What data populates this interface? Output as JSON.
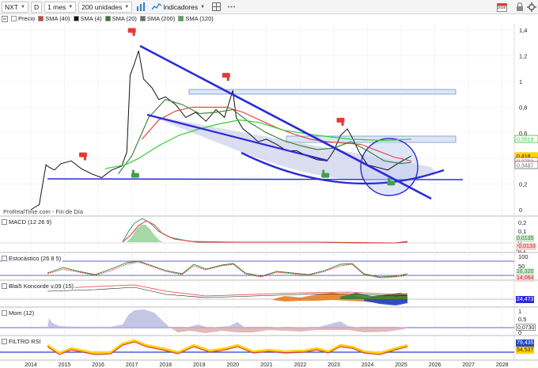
{
  "toolbar": {
    "symbol": "NXT",
    "mode": "D",
    "period": "1 mes",
    "units": "200 unidades",
    "indicators_label": "Indicadores",
    "year_badge": "2028"
  },
  "legend": [
    {
      "label": "Precio",
      "color": "#ffffff"
    },
    {
      "label": "SMA (40)",
      "color": "#e53935"
    },
    {
      "label": "SMA (4)",
      "color": "#111111"
    },
    {
      "label": "SMA (20)",
      "color": "#2e7d32"
    },
    {
      "label": "SMA (200)",
      "color": "#6d6d6d"
    },
    {
      "label": "SMA (120)",
      "color": "#4caf50"
    }
  ],
  "watermark": "ProRealTime.com - Fin de Día",
  "indicators": {
    "macd": "MACD (12 26 9)",
    "stoch": "Estocástico (26 8 5)",
    "blai5": "Blai5 Koncorde v.09 (15)",
    "mom": "Mom (12)",
    "rsi": "FILTRO RSI"
  },
  "colors": {
    "price_line": "#111111",
    "sma40": "#e53935",
    "sma20": "#2e7d32",
    "sma120": "#33cc33",
    "trendline": "#2b2bd6",
    "channel_fill": "#c8cbe8",
    "circle_fill": "#c5d1f5",
    "resistance_box": "#dbe6f7",
    "sell_flag": "#e53935",
    "buy_thumb": "#43a047"
  },
  "chart_data": [
    {
      "type": "line",
      "title": "",
      "x_unit": "year",
      "x_ticks": [
        "2014",
        "2015",
        "2016",
        "2017",
        "2018",
        "2019",
        "2020",
        "2021",
        "2022",
        "2023",
        "2024",
        "2025",
        "2026",
        "2027",
        "2028"
      ],
      "y_ticks": [
        "1,4",
        "1,2",
        "1",
        "0,8",
        "0,6",
        "0,4",
        "0,2",
        "0"
      ],
      "ylim": [
        0,
        1.45
      ],
      "last_value": "0,418",
      "price_tags": [
        {
          "label": "0,5519",
          "y": 0.5519,
          "color": "#33cc33"
        },
        {
          "label": "0,418",
          "y": 0.418,
          "color": "#ffd400"
        },
        {
          "label": "0,3792",
          "y": 0.3792,
          "color": "#e53935"
        },
        {
          "label": "0,3487",
          "y": 0.3487,
          "color": "#6d6d6d"
        }
      ],
      "series": [
        {
          "name": "Precio",
          "x": [
            2014.0,
            2014.25,
            2014.45,
            2014.55,
            2014.7,
            2014.9,
            2015.2,
            2015.5,
            2015.8,
            2016.1,
            2016.4,
            2016.7,
            2016.85,
            2016.95,
            2017.05,
            2017.2,
            2017.35,
            2017.6,
            2017.8,
            2018.0,
            2018.3,
            2018.6,
            2018.9,
            2019.2,
            2019.5,
            2019.75,
            2020.0,
            2020.1,
            2020.3,
            2020.5,
            2020.75,
            2021.0,
            2021.3,
            2021.6,
            2021.9,
            2022.2,
            2022.5,
            2022.8,
            2023.0,
            2023.2,
            2023.4,
            2023.55,
            2023.75,
            2024.0,
            2024.3,
            2024.6,
            2024.9,
            2025.1,
            2025.3
          ],
          "y": [
            0.0,
            0.04,
            0.35,
            0.33,
            0.31,
            0.36,
            0.38,
            0.32,
            0.28,
            0.25,
            0.31,
            0.34,
            0.45,
            1.05,
            1.12,
            1.24,
            1.02,
            0.95,
            0.86,
            0.88,
            0.82,
            0.72,
            0.76,
            0.69,
            0.78,
            0.72,
            0.93,
            0.72,
            0.63,
            0.59,
            0.53,
            0.55,
            0.51,
            0.46,
            0.46,
            0.42,
            0.39,
            0.38,
            0.46,
            0.58,
            0.63,
            0.56,
            0.45,
            0.35,
            0.33,
            0.31,
            0.36,
            0.39,
            0.42
          ]
        },
        {
          "name": "SMA (40)",
          "x": [
            2017.3,
            2017.8,
            2018.3,
            2018.8,
            2019.3,
            2019.8,
            2020.3,
            2020.8,
            2021.3,
            2021.8,
            2022.3,
            2022.8,
            2023.3,
            2023.8,
            2024.3,
            2024.8,
            2025.3
          ],
          "y": [
            0.55,
            0.7,
            0.77,
            0.8,
            0.8,
            0.8,
            0.76,
            0.7,
            0.64,
            0.59,
            0.55,
            0.53,
            0.52,
            0.51,
            0.46,
            0.41,
            0.38
          ]
        },
        {
          "name": "SMA (20)",
          "x": [
            2016.6,
            2017.0,
            2017.5,
            2018.0,
            2018.5,
            2019.0,
            2019.5,
            2020.0,
            2020.5,
            2021.0,
            2021.5,
            2022.0,
            2022.5,
            2023.0,
            2023.5,
            2024.0,
            2024.5,
            2025.0,
            2025.3
          ],
          "y": [
            0.28,
            0.42,
            0.72,
            0.86,
            0.82,
            0.75,
            0.76,
            0.78,
            0.68,
            0.6,
            0.54,
            0.5,
            0.47,
            0.48,
            0.53,
            0.46,
            0.38,
            0.36,
            0.37
          ]
        },
        {
          "name": "SMA (120)",
          "x": [
            2016.2,
            2016.8,
            2017.2,
            2017.8,
            2018.4,
            2019.0,
            2019.6,
            2020.2,
            2020.8,
            2021.5,
            2022.5,
            2023.5,
            2024.5,
            2025.3
          ],
          "y": [
            0.32,
            0.35,
            0.4,
            0.5,
            0.58,
            0.63,
            0.67,
            0.7,
            0.68,
            0.62,
            0.58,
            0.55,
            0.54,
            0.55
          ]
        }
      ],
      "annotations": [
        {
          "kind": "sell-flag",
          "x": 2015.55,
          "y": 0.41
        },
        {
          "kind": "sell-flag",
          "x": 2017.0,
          "y": 1.38
        },
        {
          "kind": "sell-flag",
          "x": 2019.8,
          "y": 1.03
        },
        {
          "kind": "sell-flag",
          "x": 2023.2,
          "y": 0.68
        },
        {
          "kind": "buy-thumb",
          "x": 2017.1,
          "y": 0.28
        },
        {
          "kind": "buy-thumb",
          "x": 2022.75,
          "y": 0.28
        },
        {
          "kind": "buy-thumb",
          "x": 2024.7,
          "y": 0.22
        }
      ]
    },
    {
      "type": "line",
      "name": "MACD (12 26 9)",
      "y_ticks": [
        "0,2",
        "0,1",
        "0",
        "-0,1"
      ],
      "last_values": [
        "0,0135",
        "-0,0133"
      ]
    },
    {
      "type": "line",
      "name": "Estocástico (26 8 5)",
      "y_ticks": [
        "100",
        "50",
        "0"
      ],
      "last_values": [
        "16,320",
        "14,064"
      ]
    },
    {
      "type": "area",
      "name": "Blai5 Koncorde v.09 (15)",
      "last_values": [
        "24,473"
      ]
    },
    {
      "type": "area",
      "name": "Mom (12)",
      "y_ticks": [
        "1",
        "0,5",
        "0"
      ],
      "last_values": [
        "0,0730"
      ]
    },
    {
      "type": "area",
      "name": "FILTRO RSI",
      "last_values": [
        "79,435",
        "54,537"
      ]
    }
  ]
}
